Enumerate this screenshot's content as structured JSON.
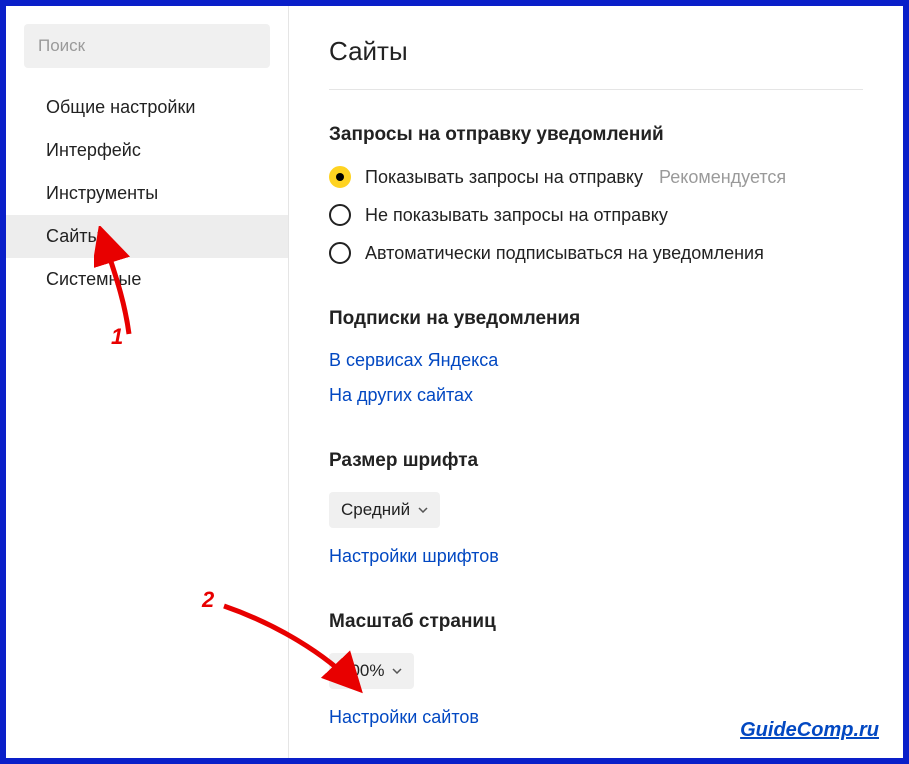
{
  "sidebar": {
    "search_placeholder": "Поиск",
    "items": [
      {
        "label": "Общие настройки"
      },
      {
        "label": "Интерфейс"
      },
      {
        "label": "Инструменты"
      },
      {
        "label": "Сайты"
      },
      {
        "label": "Системные"
      }
    ],
    "active_index": 3
  },
  "page": {
    "title": "Сайты"
  },
  "notifications": {
    "title": "Запросы на отправку уведомлений",
    "options": [
      {
        "label": "Показывать запросы на отправку",
        "hint": "Рекомендуется"
      },
      {
        "label": "Не показывать запросы на отправку"
      },
      {
        "label": "Автоматически подписываться на уведомления"
      }
    ],
    "selected_index": 0
  },
  "subscriptions": {
    "title": "Подписки на уведомления",
    "links": [
      "В сервисах Яндекса",
      "На других сайтах"
    ]
  },
  "font": {
    "title": "Размер шрифта",
    "value": "Средний",
    "settings_link": "Настройки шрифтов"
  },
  "zoom": {
    "title": "Масштаб страниц",
    "value": "100%",
    "settings_link": "Настройки сайтов"
  },
  "annotations": {
    "num1": "1",
    "num2": "2"
  },
  "watermark": "GuideComp.ru"
}
